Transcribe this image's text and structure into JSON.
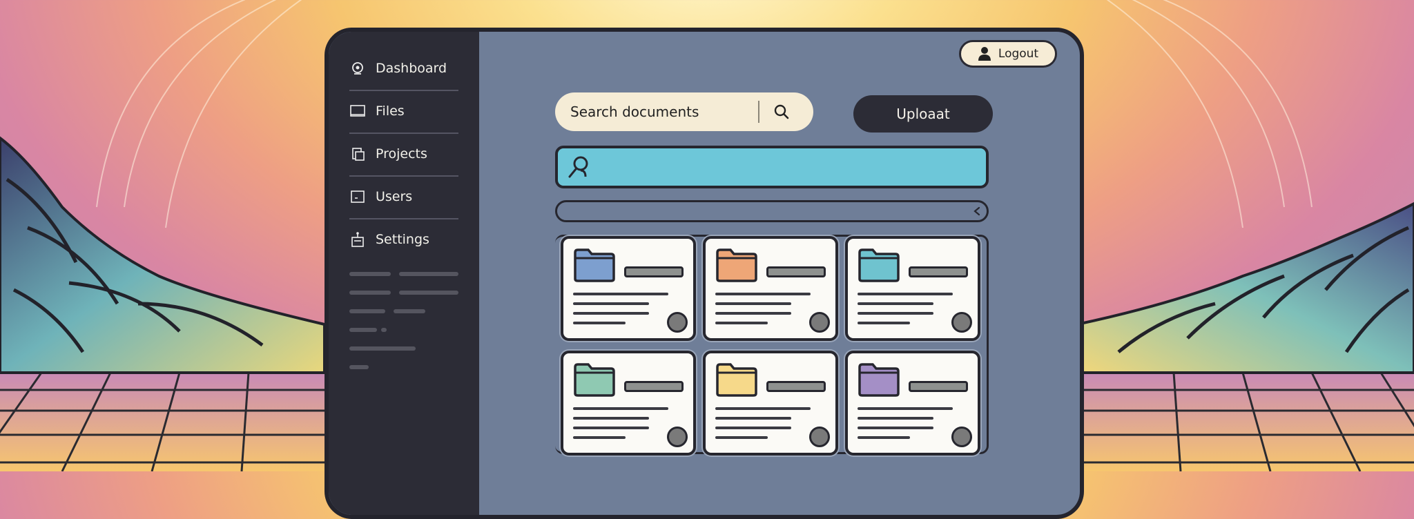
{
  "sidebar": {
    "items": [
      {
        "label": "Dashboard",
        "icon": "dashboard-icon"
      },
      {
        "label": "Files",
        "icon": "files-icon"
      },
      {
        "label": "Projects",
        "icon": "projects-icon"
      },
      {
        "label": "Users",
        "icon": "users-icon"
      },
      {
        "label": "Settings",
        "icon": "settings-icon"
      }
    ]
  },
  "header": {
    "logout_label": "Logout",
    "search_placeholder": "Search documents",
    "upload_label": "Uploaat"
  },
  "colors": {
    "sidebar_bg": "#2c2c36",
    "main_bg": "#6f7e98",
    "search_bar": "#6dc7d9",
    "folder_colors": [
      "#7d9fcf",
      "#eea677",
      "#6fc3cf",
      "#8fc9b2",
      "#f6d98a",
      "#a48fc6"
    ]
  }
}
